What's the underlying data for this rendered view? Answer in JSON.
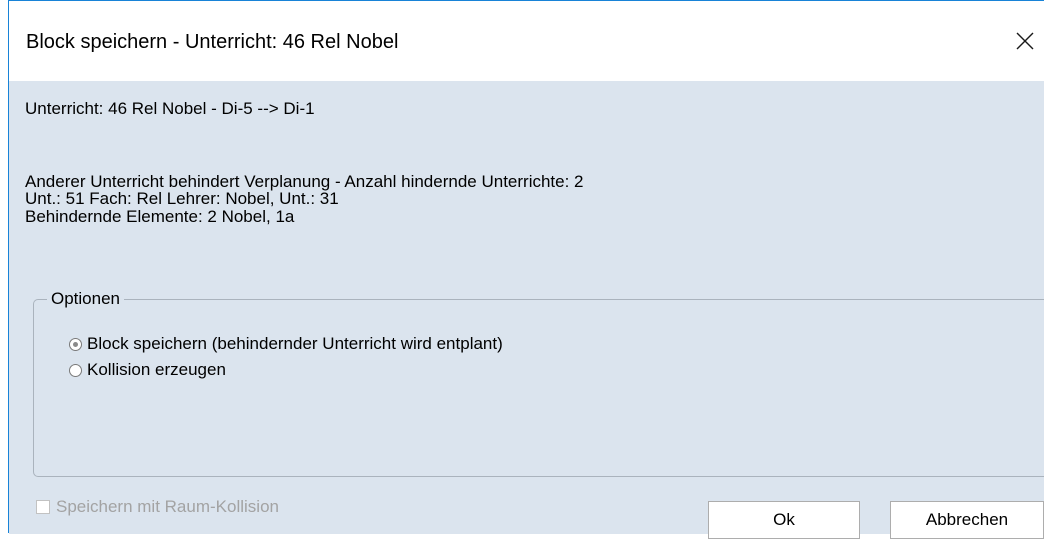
{
  "window": {
    "title": "Block speichern - Unterricht: 46 Rel Nobel",
    "close_glyph": "close-icon"
  },
  "info": {
    "lesson_line": "Unterricht: 46 Rel Nobel - Di-5 --> Di-1",
    "conflict_line1": "Anderer Unterricht behindert Verplanung - Anzahl hindernde Unterrichte: 2",
    "conflict_line2": "Unt.: 51 Fach: Rel Lehrer: Nobel, Unt.: 31",
    "conflict_line3": "Behindernde Elemente: 2 Nobel, 1a"
  },
  "options": {
    "legend": "Optionen",
    "radio_items": [
      {
        "label": "Block speichern (behindernder Unterricht wird entplant)",
        "checked": true
      },
      {
        "label": "Kollision erzeugen",
        "checked": false
      }
    ]
  },
  "footer": {
    "checkbox_label": "Speichern mit Raum-Kollision",
    "checkbox_checked": false,
    "checkbox_enabled": false,
    "ok_label": "Ok",
    "cancel_label": "Abbrechen"
  },
  "colors": {
    "title_bar": "#ffffff",
    "client_bg": "#dbe4ee",
    "window_border": "#1883d7",
    "disabled_text": "#a3a3a3"
  }
}
